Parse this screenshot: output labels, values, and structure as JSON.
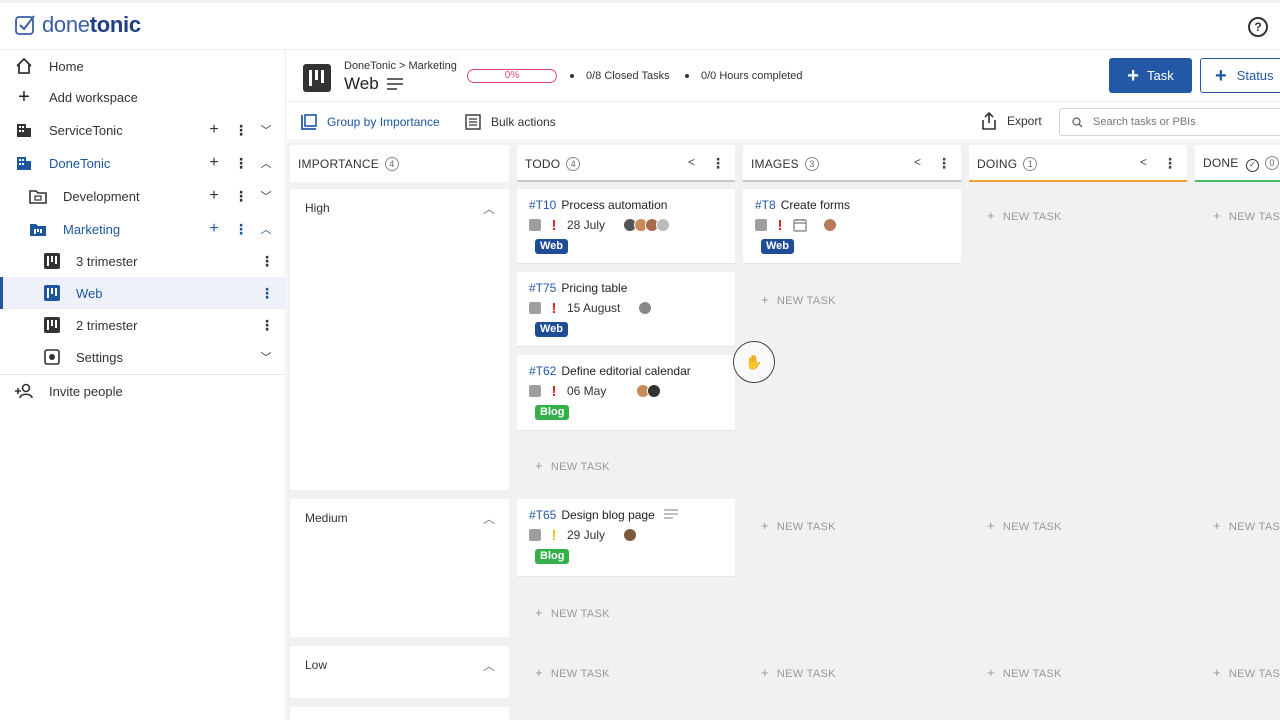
{
  "app": {
    "logo_part1": "done",
    "logo_part2": "tonic",
    "help_label": "?"
  },
  "sidebar": {
    "items": [
      {
        "label": "Home",
        "icon": "home-icon"
      },
      {
        "label": "Add workspace",
        "icon": "plus-icon"
      },
      {
        "label": "ServiceTonic",
        "icon": "building-icon"
      },
      {
        "label": "DoneTonic",
        "icon": "building-icon"
      },
      {
        "label": "Development",
        "icon": "folder-icon"
      },
      {
        "label": "Marketing",
        "icon": "folder-icon"
      },
      {
        "label": "3 trimester",
        "icon": "board-icon"
      },
      {
        "label": "Web",
        "icon": "board-icon"
      },
      {
        "label": "2 trimester",
        "icon": "board-icon"
      },
      {
        "label": "Settings",
        "icon": "settings-icon"
      },
      {
        "label": "Invite people",
        "icon": "add-person-icon"
      }
    ]
  },
  "header": {
    "breadcrumb": "DoneTonic > Marketing",
    "board_name": "Web",
    "progress": "0%",
    "closed_tasks": "0/8 Closed Tasks",
    "hours": "0/0 Hours completed",
    "task_button": "Task",
    "status_button": "Status"
  },
  "toolbar": {
    "group_by": "Group by Importance",
    "bulk": "Bulk actions",
    "export": "Export",
    "search_placeholder": "Search tasks or PBIs"
  },
  "columns": {
    "importance": {
      "title": "IMPORTANCE",
      "count": "4"
    },
    "todo": {
      "title": "TODO",
      "count": "4"
    },
    "images": {
      "title": "IMAGES",
      "count": "3"
    },
    "doing": {
      "title": "DOING",
      "count": "1"
    },
    "done": {
      "title": "DONE",
      "count": "0"
    }
  },
  "lanes": {
    "high": "High",
    "medium": "Medium",
    "low": "Low"
  },
  "cards": {
    "t10": {
      "id": "#T10",
      "title": "Process automation",
      "date": "28 July",
      "tag": "Web"
    },
    "t75": {
      "id": "#T75",
      "title": "Pricing table",
      "date": "15 August",
      "tag": "Web"
    },
    "t62": {
      "id": "#T62",
      "title": "Define editorial calendar",
      "date": "06 May",
      "tag": "Blog"
    },
    "t8": {
      "id": "#T8",
      "title": "Create forms",
      "tag": "Web"
    },
    "t65": {
      "id": "#T65",
      "title": "Design blog page",
      "date": "29 July",
      "tag": "Blog"
    }
  },
  "new_task_label": "NEW TASK",
  "colors": {
    "brand_blue": "#2358a6",
    "tag_web": "#1f4c96",
    "tag_blog": "#34b04a",
    "prio_high": "#e02424",
    "prio_medium": "#f2c200",
    "todo_line": "#c7c7c7",
    "doing_line": "#f0a030",
    "done_line": "#44b864"
  }
}
